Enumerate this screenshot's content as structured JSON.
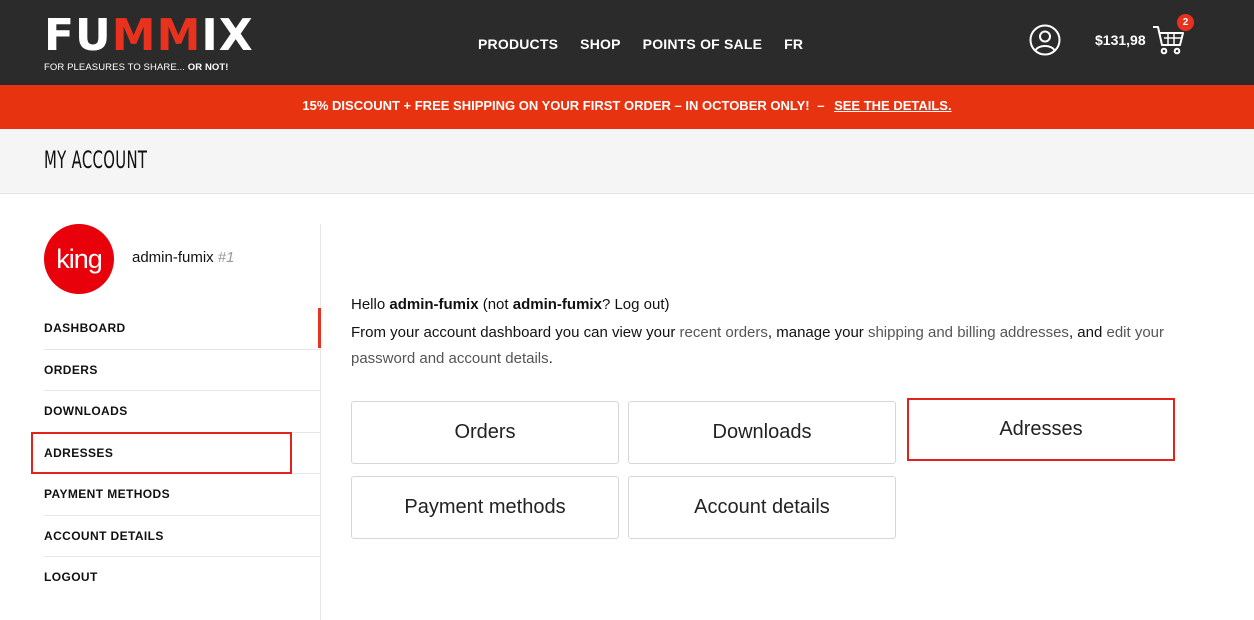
{
  "header": {
    "logo_text_start": "FU",
    "logo_text_mid": "MM",
    "logo_text_end": "IX",
    "logo_tagline": "FOR PLEASURES TO SHARE...",
    "logo_tagline_bold": "OR NOT!",
    "nav": [
      "PRODUCTS",
      "SHOP",
      "POINTS OF SALE",
      "FR"
    ],
    "cart_total": "$131,98",
    "cart_count": "2",
    "accent_color": "#e8321e"
  },
  "promo": {
    "text": "15% DISCOUNT + FREE SHIPPING ON YOUR FIRST ORDER – IN OCTOBER ONLY!",
    "separator": "–",
    "link": "SEE THE DETAILS."
  },
  "page_title": "MY ACCOUNT",
  "sidebar": {
    "avatar_text": "king",
    "username": "admin-fumix",
    "user_id": "#1",
    "menu": [
      "DASHBOARD",
      "ORDERS",
      "DOWNLOADS",
      "ADRESSES",
      "PAYMENT METHODS",
      "ACCOUNT DETAILS",
      "LOGOUT"
    ]
  },
  "main": {
    "hello_prefix": "Hello",
    "hello_user": "admin-fumix",
    "hello_not": "(not",
    "hello_user2": "admin-fumix",
    "hello_logout": "? Log out)",
    "intro_1": "From your account dashboard you can view your",
    "intro_link_orders": "recent orders",
    "intro_2": ", manage your",
    "intro_link_addresses": "shipping and billing addresses",
    "intro_3": ", and",
    "intro_link_password": "edit your password and account details",
    "intro_4": ".",
    "tiles": [
      "Orders",
      "Downloads",
      "Adresses",
      "Payment methods",
      "Account details"
    ]
  }
}
